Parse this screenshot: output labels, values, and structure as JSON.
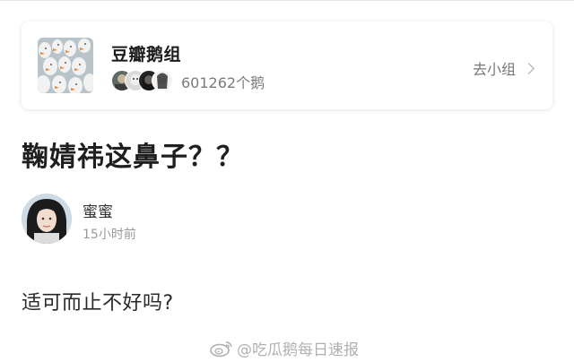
{
  "group": {
    "name": "豆瓣鹅组",
    "member_count": "601262个鹅",
    "go_label": "去小组"
  },
  "post": {
    "title": "鞠婧祎这鼻子？？",
    "author": "蜜蜜",
    "time": "15小时前",
    "body": "适可而止不好吗?"
  },
  "watermark": {
    "text": "@吃瓜鹅每日速报"
  },
  "icons": {
    "chevron": "chevron-right-icon",
    "weibo": "weibo-icon"
  },
  "colors": {
    "title": "#1f1f1f",
    "meta": "#9a9a9a",
    "card_shadow": "#e6e6e6"
  }
}
